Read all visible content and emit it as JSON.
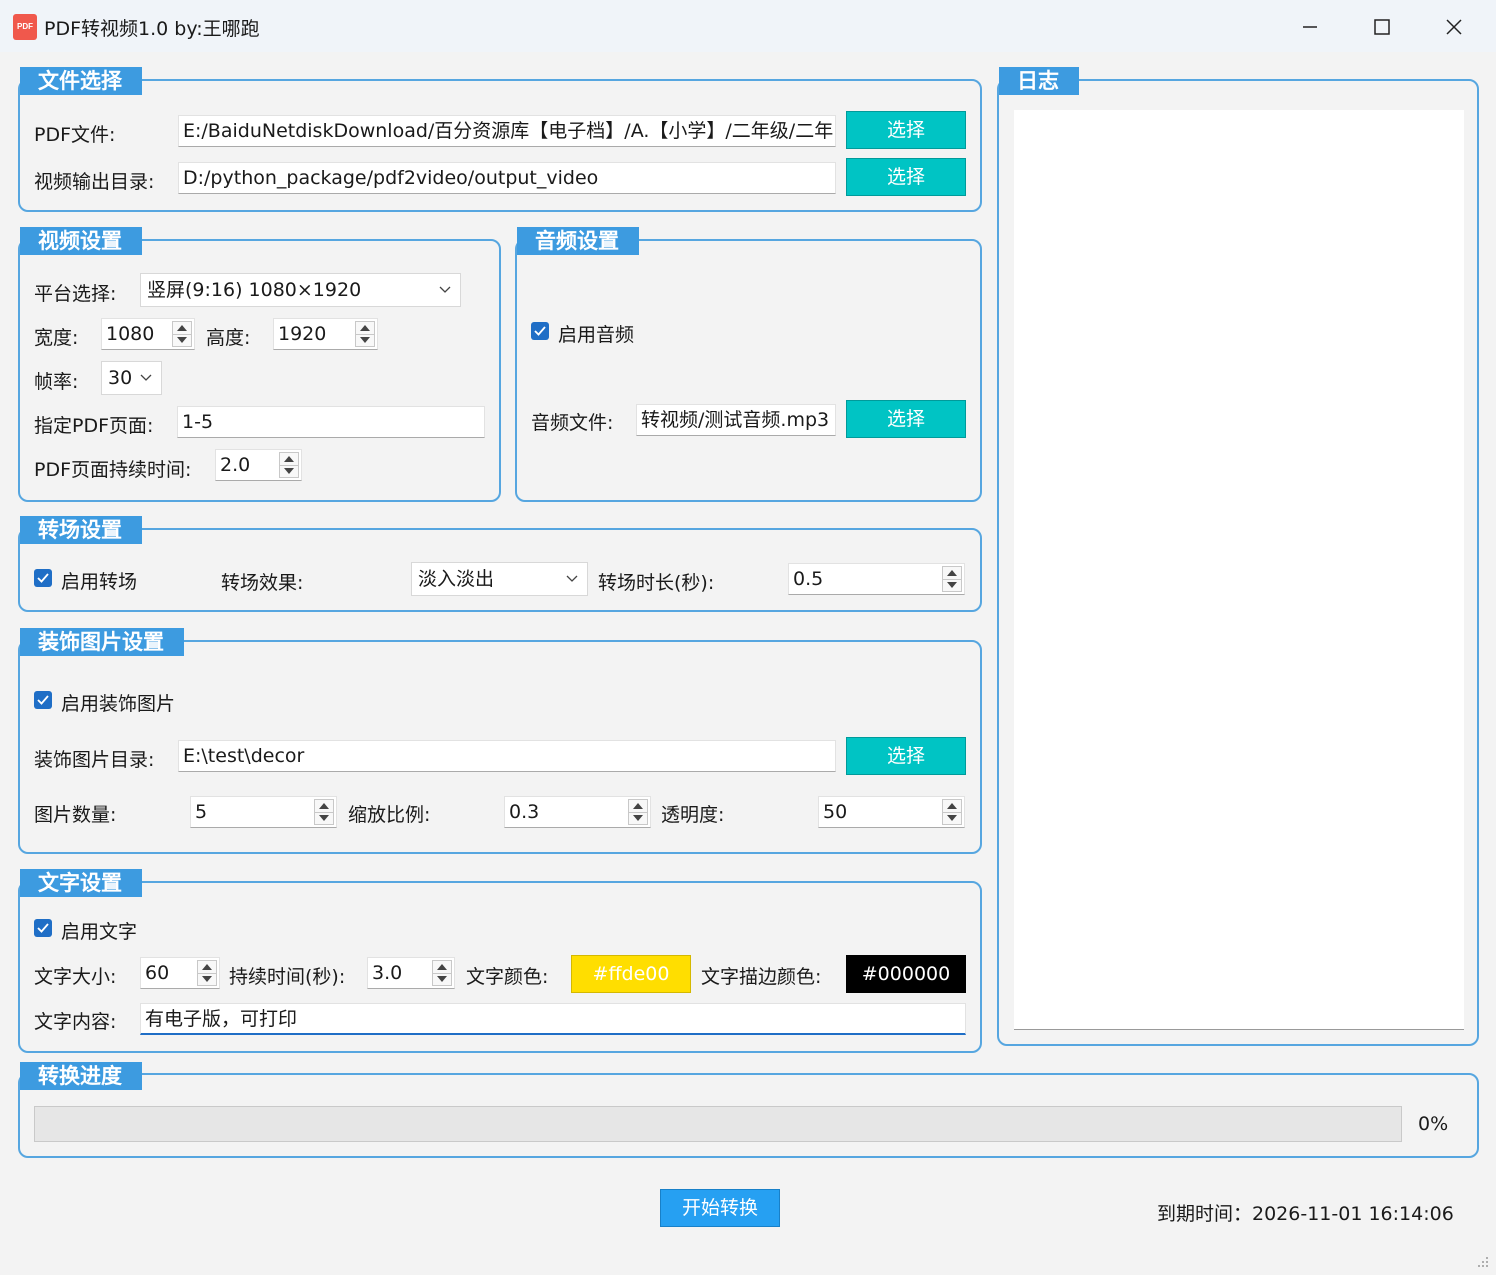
{
  "window": {
    "icon_text": "PDF",
    "title": "PDF转视频1.0 by:王哪跑"
  },
  "file_select": {
    "title": "文件选择",
    "pdf_label": "PDF文件:",
    "pdf_value": "E:/BaiduNetdiskDownload/百分资源库【电子档】/A.【小学】/二年级/二年",
    "output_label": "视频输出目录:",
    "output_value": "D:/python_package/pdf2video/output_video",
    "select_label": "选择"
  },
  "video": {
    "title": "视频设置",
    "platform_label": "平台选择:",
    "platform_value": "竖屏(9:16) 1080×1920",
    "width_label": "宽度:",
    "width_value": "1080",
    "height_label": "高度:",
    "height_value": "1920",
    "fps_label": "帧率:",
    "fps_value": "30",
    "pages_label": "指定PDF页面:",
    "pages_value": "1-5",
    "duration_label": "PDF页面持续时间:",
    "duration_value": "2.0"
  },
  "audio": {
    "title": "音频设置",
    "enable_label": "启用音频",
    "file_label": "音频文件:",
    "file_value": "转视频/测试音频.mp3",
    "select_label": "选择"
  },
  "transition": {
    "title": "转场设置",
    "enable_label": "启用转场",
    "effect_label": "转场效果:",
    "effect_value": "淡入淡出",
    "duration_label": "转场时长(秒):",
    "duration_value": "0.5"
  },
  "decor": {
    "title": "装饰图片设置",
    "enable_label": "启用装饰图片",
    "dir_label": "装饰图片目录:",
    "dir_value": "E:\\test\\decor",
    "select_label": "选择",
    "count_label": "图片数量:",
    "count_value": "5",
    "scale_label": "缩放比例:",
    "scale_value": "0.3",
    "opacity_label": "透明度:",
    "opacity_value": "50"
  },
  "text": {
    "title": "文字设置",
    "enable_label": "启用文字",
    "size_label": "文字大小:",
    "size_value": "60",
    "duration_label": "持续时间(秒):",
    "duration_value": "3.0",
    "color_label": "文字颜色:",
    "color_value": "#ffde00",
    "stroke_label": "文字描边颜色:",
    "stroke_value": "#000000",
    "content_label": "文字内容:",
    "content_value": "有电子版，可打印"
  },
  "log": {
    "title": "日志"
  },
  "progress": {
    "title": "转换进度",
    "percent": 0,
    "percent_text": "0%"
  },
  "footer": {
    "start_label": "开始转换",
    "expiry": "到期时间：2026-11-01 16:14:06"
  },
  "colors": {
    "accent": "#3d9be0",
    "select_button": "#00c4c4",
    "text_color_swatch": "#ffde00",
    "stroke_color_swatch": "#000000",
    "start_button": "#26a0f2"
  }
}
